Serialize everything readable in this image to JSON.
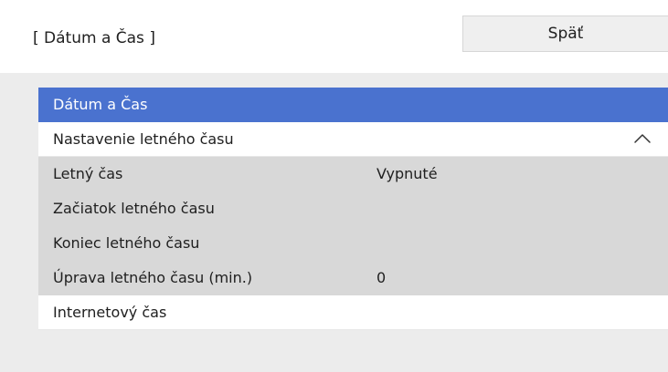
{
  "header": {
    "title": "[ Dátum a Čas ]",
    "back_label": "Späť"
  },
  "menu": {
    "items": [
      {
        "label": "Dátum a Čas",
        "value": "",
        "state": "selected"
      },
      {
        "label": "Nastavenie letného času",
        "value": "",
        "state": "expanded",
        "icon": "chevron-up-icon"
      },
      {
        "label": "Letný čas",
        "value": "Vypnuté",
        "state": "submenu"
      },
      {
        "label": "Začiatok letného času",
        "value": "",
        "state": "submenu"
      },
      {
        "label": "Koniec letného času",
        "value": "",
        "state": "submenu"
      },
      {
        "label": "Úprava letného času (min.)",
        "value": "0",
        "state": "submenu"
      },
      {
        "label": "Internetový čas",
        "value": "",
        "state": "normal"
      }
    ]
  },
  "colors": {
    "selected": "#4a72cf",
    "submenu_bg": "#d8d8d8",
    "row_bg": "#ffffff",
    "page_bg": "#ececec"
  }
}
